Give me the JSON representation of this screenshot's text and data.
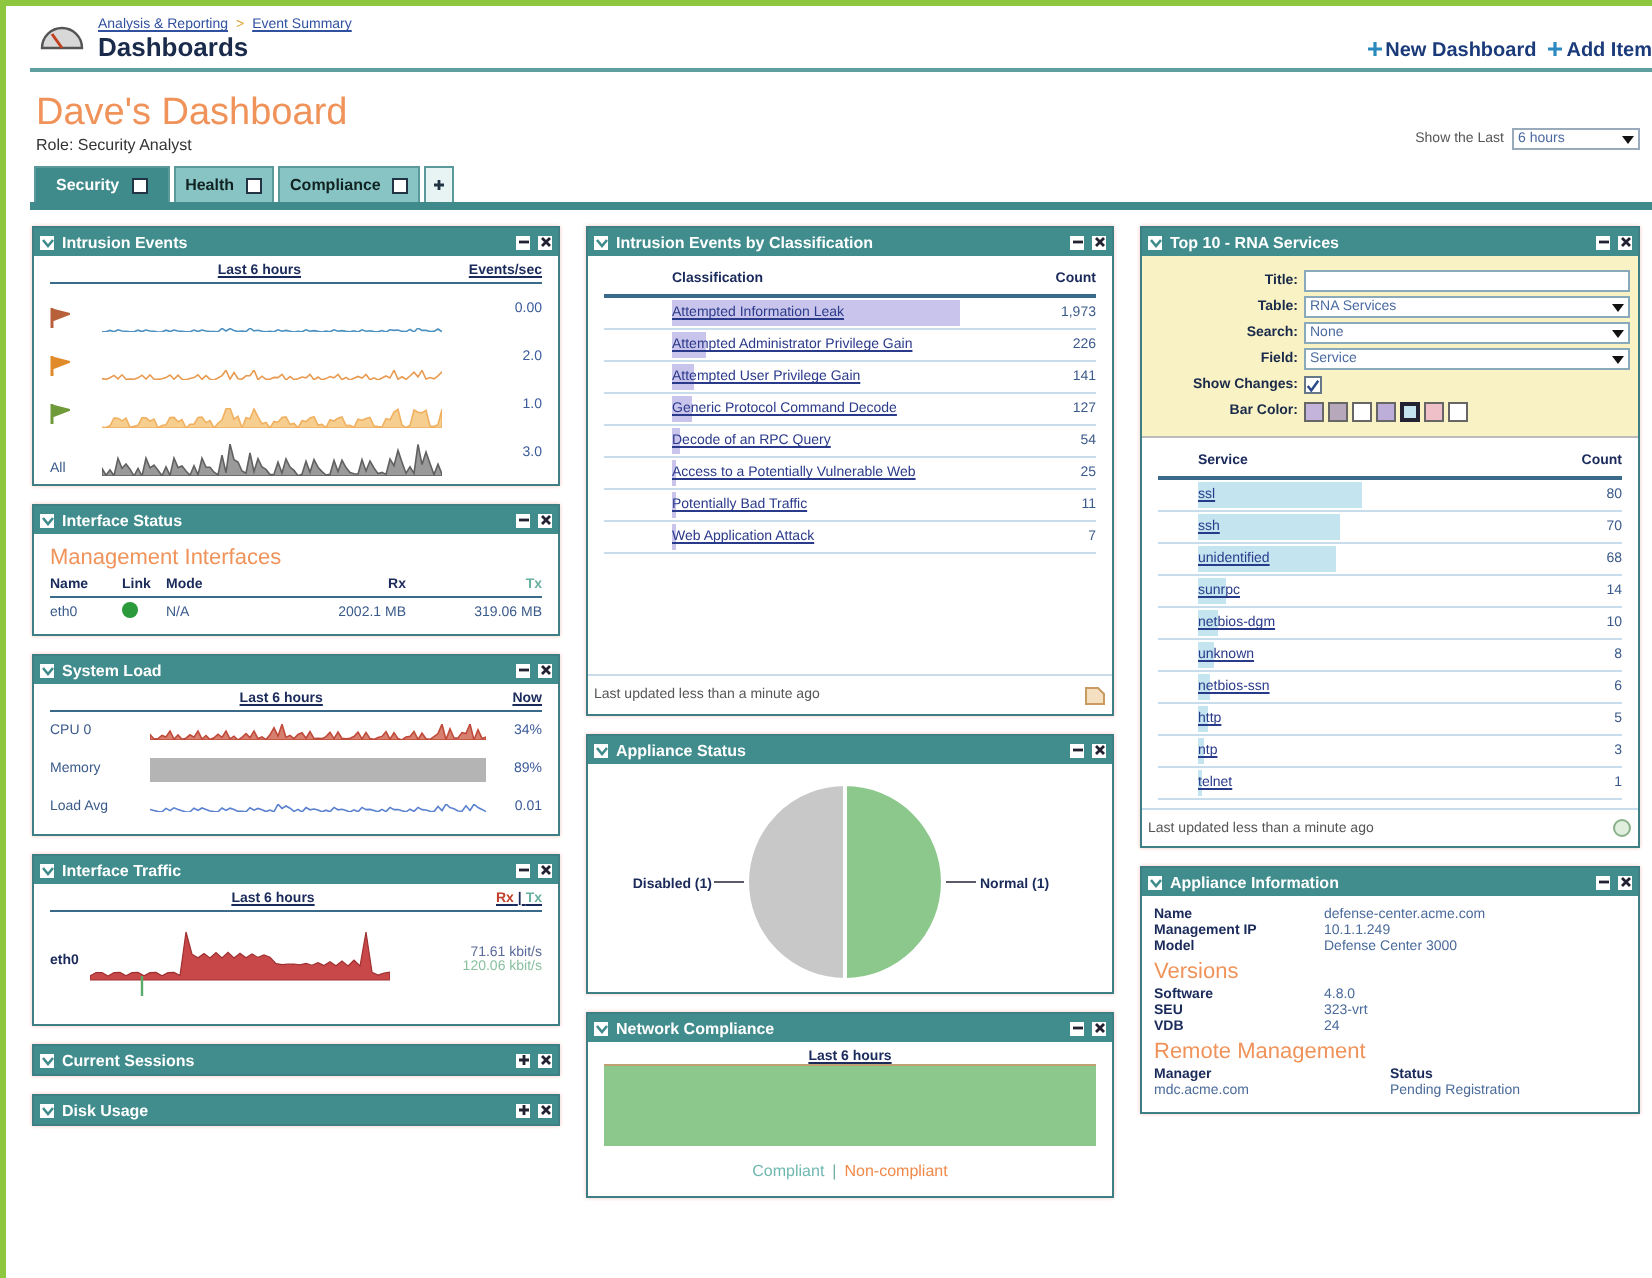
{
  "breadcrumb": [
    {
      "label": "Analysis & Reporting"
    },
    {
      "label": "Event Summary"
    }
  ],
  "breadcrumb_separator": ">",
  "page_title": "Dashboards",
  "actions": [
    {
      "label": "New Dashboard"
    },
    {
      "label": "Add Item"
    }
  ],
  "dashboard": {
    "title": "Dave's Dashboard",
    "role": "Role: Security Analyst"
  },
  "time_filter": {
    "label": "Show the Last",
    "value": "6 hours"
  },
  "tabs": [
    {
      "label": "Security",
      "selected": true
    },
    {
      "label": "Health",
      "selected": false
    },
    {
      "label": "Compliance",
      "selected": false
    }
  ],
  "columns": [
    {
      "panels": [
        {
          "kind": "sparklines",
          "title": "Intrusion Events",
          "collapsed": false,
          "heading": "Last 6 hours",
          "value_heading": "Events/sec",
          "rows": [
            {
              "color": "#b8603a",
              "value": "0.00"
            },
            {
              "color": "#e08a2a",
              "value": "2.0"
            },
            {
              "color": "#6f9a3a",
              "value": "1.0"
            },
            {
              "label": "All",
              "value": "3.0"
            }
          ]
        },
        {
          "kind": "interfaces",
          "title": "Interface Status",
          "collapsed": false,
          "heading": "Management Interfaces",
          "columns": [
            "Name",
            "Link",
            "Mode",
            "Rx",
            "Tx"
          ],
          "rows": [
            {
              "name": "eth0",
              "link_up": true,
              "mode": "N/A",
              "rx": "2002.1 MB",
              "tx": "319.06 MB"
            }
          ]
        },
        {
          "kind": "load",
          "title": "System Load",
          "collapsed": false,
          "heading": "Last 6 hours",
          "value_heading": "Now",
          "rows": [
            {
              "label": "CPU 0",
              "value": "34%"
            },
            {
              "label": "Memory",
              "value": "89%"
            },
            {
              "label": "Load Avg",
              "value": "0.01"
            }
          ]
        },
        {
          "kind": "traffic",
          "title": "Interface Traffic",
          "collapsed": false,
          "heading": "Last 6 hours",
          "rx_label": "Rx",
          "separator": "|",
          "tx_label": "Tx",
          "interface": "eth0",
          "rx": "71.61 kbit/s",
          "tx": "120.06 kbit/s"
        },
        {
          "title": "Current Sessions",
          "collapsed": true
        },
        {
          "title": "Disk Usage",
          "collapsed": true
        }
      ]
    },
    {
      "panels": [
        {
          "kind": "classification",
          "title": "Intrusion Events by Classification",
          "collapsed": false,
          "columns": [
            "Classification",
            "Count"
          ],
          "rows": [
            {
              "label": "Attempted Information Leak",
              "count": "1,973"
            },
            {
              "label": "Attempted Administrator Privilege Gain",
              "count": "226"
            },
            {
              "label": "Attempted User Privilege Gain",
              "count": "141"
            },
            {
              "label": "Generic Protocol Command Decode",
              "count": "127"
            },
            {
              "label": "Decode of an RPC Query",
              "count": "54"
            },
            {
              "label": "Access to a Potentially Vulnerable Web",
              "count": "25"
            },
            {
              "label": "Potentially Bad Traffic",
              "count": "11"
            },
            {
              "label": "Web Application Attack",
              "count": "7"
            }
          ],
          "footer": "Last updated less than a minute ago"
        },
        {
          "kind": "pie",
          "title": "Appliance Status",
          "collapsed": false,
          "chart_data": {
            "type": "pie",
            "categories": [
              "Disabled (1)",
              "Normal (1)"
            ],
            "values": [
              1,
              1
            ],
            "colors": [
              "#c8c8c8",
              "#8cc88c"
            ]
          }
        },
        {
          "kind": "compliance",
          "title": "Network Compliance",
          "collapsed": false,
          "heading": "Last 6 hours",
          "legend": [
            {
              "label": "Compliant",
              "color": "#6fb8b0"
            },
            {
              "label": "Non-compliant",
              "color": "#f08a4b"
            }
          ],
          "separator": "|"
        }
      ]
    },
    {
      "panels": [
        {
          "kind": "top10",
          "title": "Top 10 - RNA Services",
          "collapsed": false,
          "form": [
            {
              "kind": "text",
              "label": "Title:"
            },
            {
              "kind": "select",
              "label": "Table:",
              "value": "RNA Services"
            },
            {
              "kind": "select",
              "label": "Search:",
              "value": "None"
            },
            {
              "kind": "select",
              "label": "Field:",
              "value": "Service"
            },
            {
              "kind": "check",
              "label": "Show Changes:",
              "checked": true
            },
            {
              "kind": "swatches",
              "label": "Bar Color:",
              "swatches": [
                {
                  "color": "#c4b4dc",
                  "selected": false
                },
                {
                  "color": "#b8a8bc",
                  "selected": false
                },
                {
                  "color": "#ffffff",
                  "selected": false
                },
                {
                  "color": "#bcaed8",
                  "selected": false
                },
                {
                  "color": "#c4e4f0",
                  "selected": true
                },
                {
                  "color": "#f0c0c8",
                  "selected": false
                },
                {
                  "color": "#ffffff",
                  "selected": false
                }
              ]
            }
          ],
          "columns": [
            "Service",
            "Count"
          ],
          "rows": [
            {
              "label": "ssl",
              "count": "80"
            },
            {
              "label": "ssh",
              "count": "70"
            },
            {
              "label": "unidentified",
              "count": "68"
            },
            {
              "label": "sunrpc",
              "count": "14"
            },
            {
              "label": "netbios-dgm",
              "count": "10"
            },
            {
              "label": "unknown",
              "count": "8"
            },
            {
              "label": "netbios-ssn",
              "count": "6"
            },
            {
              "label": "http",
              "count": "5"
            },
            {
              "label": "ntp",
              "count": "3"
            },
            {
              "label": "telnet",
              "count": "1"
            }
          ],
          "footer": "Last updated less than a minute ago"
        },
        {
          "kind": "info",
          "title": "Appliance Information",
          "collapsed": false,
          "fields": [
            {
              "label": "Name",
              "value": "defense-center.acme.com"
            },
            {
              "label": "Management IP",
              "value": "10.1.1.249"
            },
            {
              "label": "Model",
              "value": "Defense Center 3000"
            }
          ],
          "versions_heading": "Versions",
          "versions": [
            {
              "label": "Software",
              "value": "4.8.0"
            },
            {
              "label": "SEU",
              "value": "323-vrt"
            },
            {
              "label": "VDB",
              "value": "24"
            }
          ],
          "remote_heading": "Remote Management",
          "remote": [
            {
              "label": "Manager",
              "value": "mdc.acme.com"
            },
            {
              "label": "Status",
              "value": "Pending Registration"
            }
          ]
        }
      ]
    }
  ]
}
